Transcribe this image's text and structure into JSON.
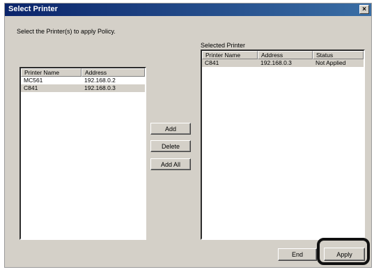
{
  "window": {
    "title": "Select Printer",
    "close_label": "×"
  },
  "instruction": "Select the Printer(s) to apply Policy.",
  "left_list": {
    "columns": [
      "Printer Name",
      "Address"
    ],
    "rows": [
      {
        "name": "MC561",
        "address": "192.168.0.2"
      },
      {
        "name": "C841",
        "address": "192.168.0.3"
      }
    ]
  },
  "right_list": {
    "label": "Selected Printer",
    "columns": [
      "Printer Name",
      "Address",
      "Status"
    ],
    "rows": [
      {
        "name": "C841",
        "address": "192.168.0.3",
        "status": "Not Applied"
      }
    ]
  },
  "buttons": {
    "add": "Add",
    "delete": "Delete",
    "add_all": "Add All",
    "end": "End",
    "apply": "Apply"
  }
}
